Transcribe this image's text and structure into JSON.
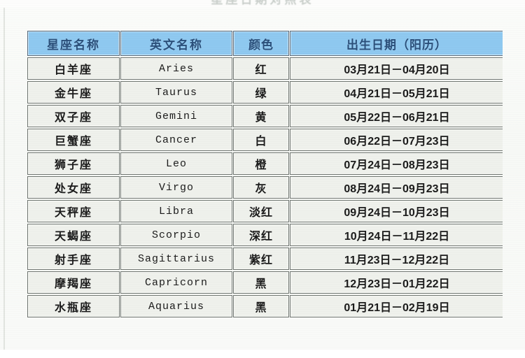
{
  "page": {
    "title_partial": "星座日期对照表",
    "background_color": "#f9faf8"
  },
  "table": {
    "header_bg": "#8fc9f0",
    "header_text_color": "#2a4f7a",
    "cell_bg": "#eff1ec",
    "border_color": "#6f7570",
    "columns": [
      {
        "key": "name",
        "label": "星座名称"
      },
      {
        "key": "en",
        "label": "英文名称"
      },
      {
        "key": "color",
        "label": "颜色"
      },
      {
        "key": "date",
        "label": "出生日期（阳历）"
      }
    ],
    "rows": [
      {
        "name": "白羊座",
        "en": "Aries",
        "color": "红",
        "date": "03月21日－04月20日"
      },
      {
        "name": "金牛座",
        "en": "Taurus",
        "color": "绿",
        "date": "04月21日－05月21日"
      },
      {
        "name": "双子座",
        "en": "Gemini",
        "color": "黄",
        "date": "05月22日－06月21日"
      },
      {
        "name": "巨蟹座",
        "en": "Cancer",
        "color": "白",
        "date": "06月22日－07月23日"
      },
      {
        "name": "狮子座",
        "en": "Leo",
        "color": "橙",
        "date": "07月24日－08月23日"
      },
      {
        "name": "处女座",
        "en": "Virgo",
        "color": "灰",
        "date": "08月24日－09月23日"
      },
      {
        "name": "天秤座",
        "en": "Libra",
        "color": "淡红",
        "date": "09月24日－10月23日"
      },
      {
        "name": "天蝎座",
        "en": "Scorpio",
        "color": "深红",
        "date": "10月24日－11月22日"
      },
      {
        "name": "射手座",
        "en": "Sagittarius",
        "color": "紫红",
        "date": "11月23日－12月22日"
      },
      {
        "name": "摩羯座",
        "en": "Capricorn",
        "color": "黑",
        "date": "12月23日－01月22日"
      },
      {
        "name": "水瓶座",
        "en": "Aquarius",
        "color": "黑",
        "date": "01月21日－02月19日"
      }
    ]
  }
}
